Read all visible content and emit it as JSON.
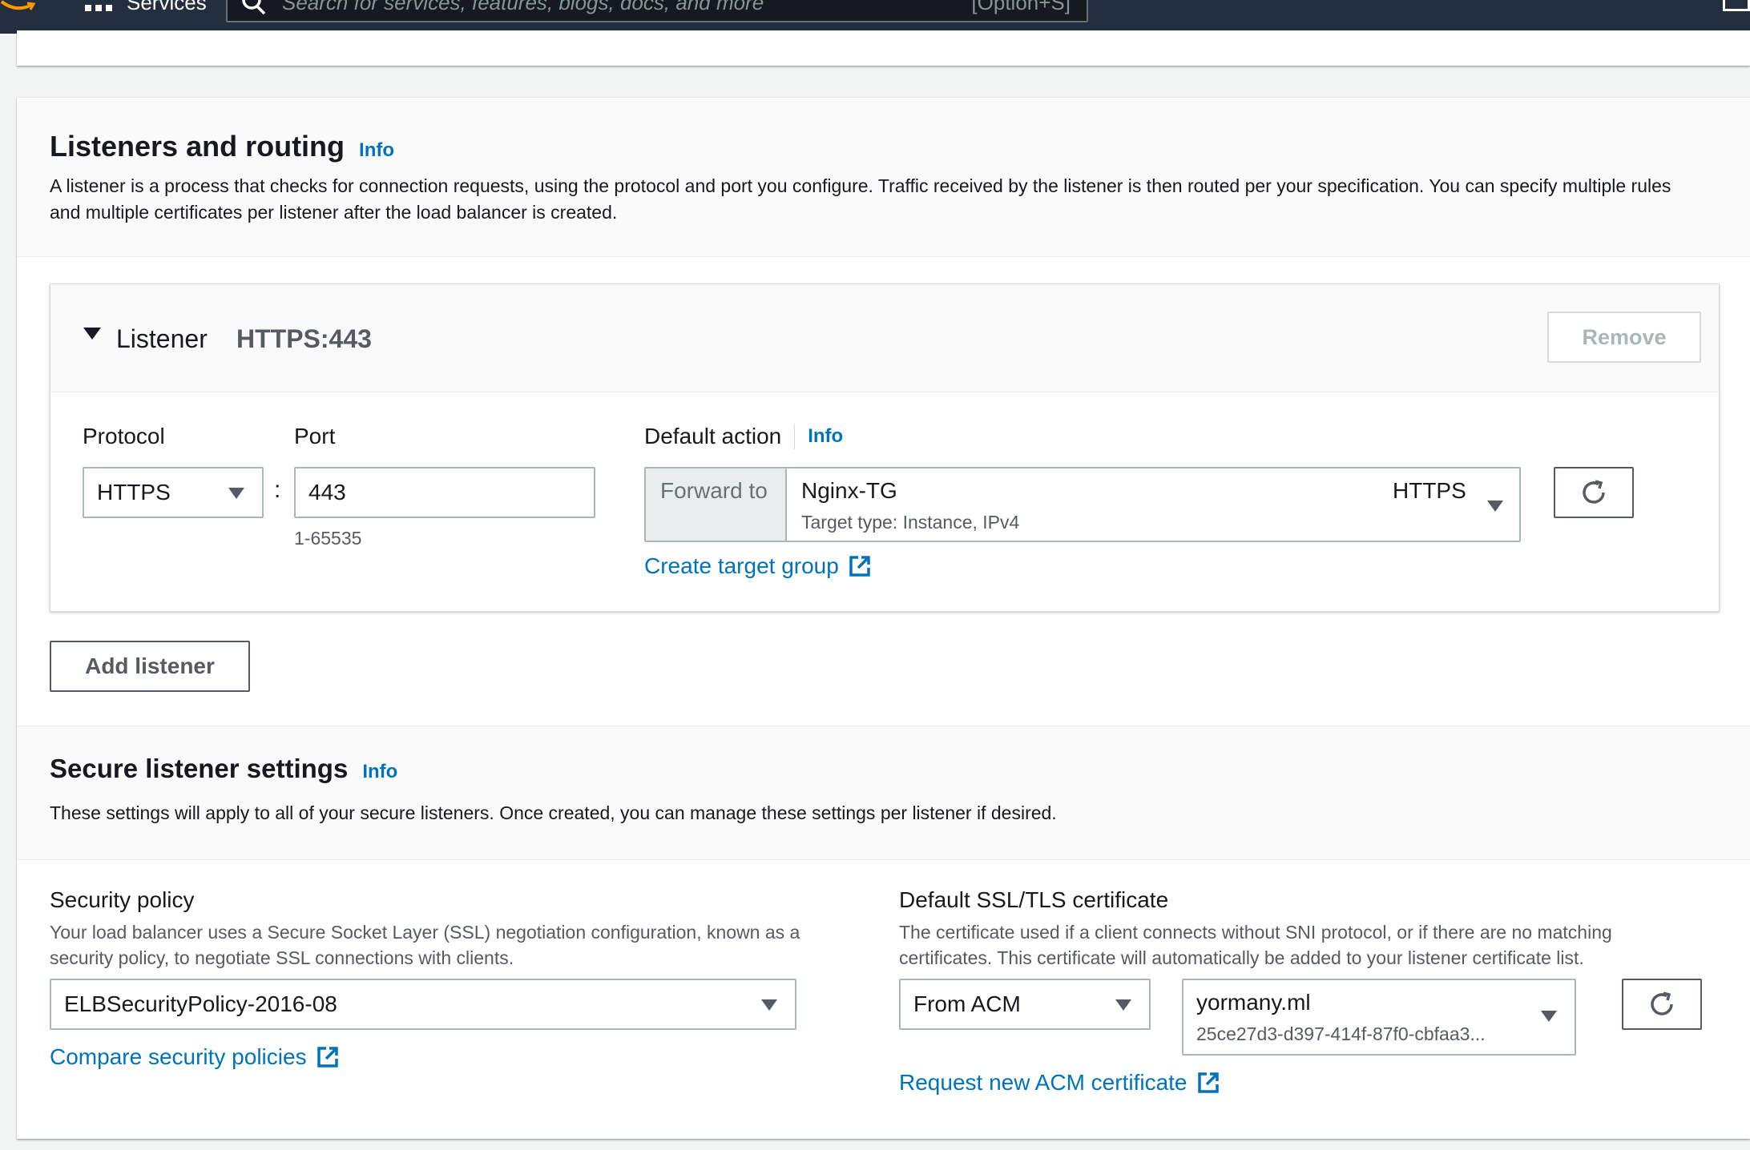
{
  "topnav": {
    "services_label": "Services",
    "search_placeholder": "Search for services, features, blogs, docs, and more",
    "search_shortcut": "[Option+S]"
  },
  "listeners": {
    "title": "Listeners and routing",
    "info": "Info",
    "description": "A listener is a process that checks for connection requests, using the protocol and port you configure. Traffic received by the listener is then routed per your specification. You can specify multiple rules and multiple certificates per listener after the load balancer is created.",
    "listener": {
      "title": "Listener",
      "value": "HTTPS:443",
      "remove_label": "Remove",
      "protocol_label": "Protocol",
      "protocol_value": "HTTPS",
      "separator": ":",
      "port_label": "Port",
      "port_value": "443",
      "port_hint": "1-65535",
      "default_action_label": "Default action",
      "default_action_info": "Info",
      "forward_to_label": "Forward to",
      "target_group_name": "Nginx-TG",
      "target_group_protocol": "HTTPS",
      "target_type": "Target type: Instance, IPv4",
      "create_target_group_link": "Create target group"
    },
    "add_listener_label": "Add listener"
  },
  "secure": {
    "title": "Secure listener settings",
    "info": "Info",
    "description": "These settings will apply to all of your secure listeners. Once created, you can manage these settings per listener if desired.",
    "security_policy": {
      "label": "Security policy",
      "description": "Your load balancer uses a Secure Socket Layer (SSL) negotiation configuration, known as a security policy, to negotiate SSL connections with clients.",
      "value": "ELBSecurityPolicy-2016-08",
      "compare_link": "Compare security policies"
    },
    "certificate": {
      "label": "Default SSL/TLS certificate",
      "description": "The certificate used if a client connects without SNI protocol, or if there are no matching certificates. This certificate will automatically be added to your listener certificate list.",
      "source_value": "From ACM",
      "cert_name": "yormany.ml",
      "cert_id": "25ce27d3-d397-414f-87f0-cbfaa3...",
      "request_link": "Request new ACM certificate"
    }
  },
  "colors": {
    "nav_bg": "#232f3e",
    "link": "#0073bb",
    "text": "#16191f",
    "muted": "#545b64"
  }
}
